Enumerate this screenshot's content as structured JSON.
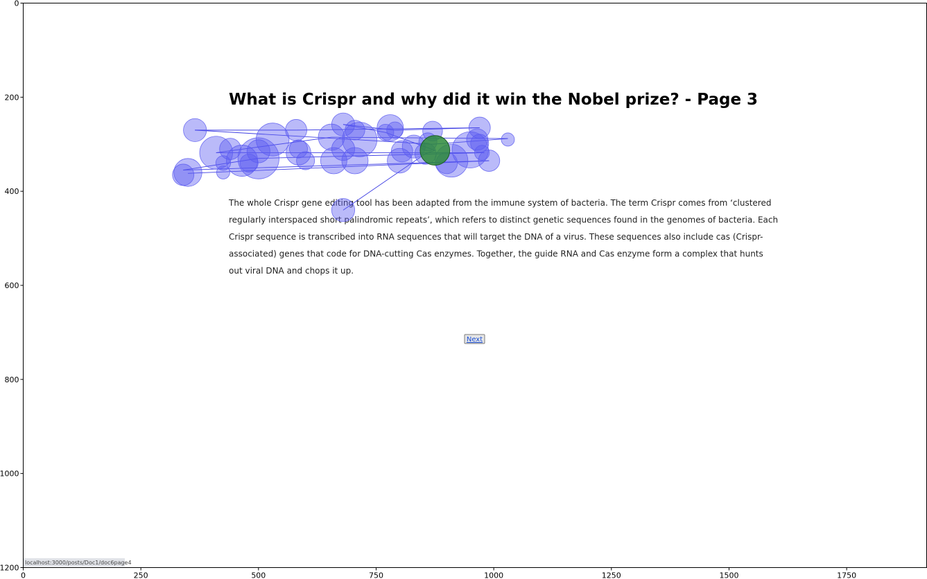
{
  "page": {
    "title": "What is Crispr and why did it win the Nobel prize? - Page 3",
    "paragraph_lines": [
      "The whole Crispr gene editing tool has been adapted from the immune system of bacteria. The term Crispr comes from ‘clustered",
      "regularly interspaced short palindromic repeats’, which refers to distinct genetic sequences found in the genomes of bacteria. Each",
      "Crispr sequence is transcribed into RNA sequences that will target the DNA of a virus. These sequences also include cas (Crispr-",
      "associated) genes that code for DNA-cutting Cas enzymes. Together, the guide RNA and Cas enzyme form a complex that hunts",
      "out viral DNA and chops it up."
    ],
    "next_button_label": "Next",
    "status_url": "localhost:3000/posts/Doc1/doc6page4"
  },
  "chart_data": {
    "type": "scatter",
    "title": "",
    "xlabel": "",
    "ylabel": "",
    "xlim": [
      0,
      1920
    ],
    "ylim": [
      1200,
      0
    ],
    "x_ticks": [
      0,
      250,
      500,
      750,
      1000,
      1250,
      1500,
      1750
    ],
    "y_ticks": [
      0,
      200,
      400,
      600,
      800,
      1000,
      1200
    ],
    "y_inverted": true,
    "grid": false,
    "colors": {
      "fixation": "#5a5af0",
      "scanpath": "#2a2ae0",
      "current_fixation": "#2e8b3a"
    },
    "fixations": [
      {
        "x": 680,
        "y": 440,
        "r": 14
      },
      {
        "x": 855,
        "y": 320,
        "r": 13
      },
      {
        "x": 830,
        "y": 305,
        "r": 14
      },
      {
        "x": 770,
        "y": 275,
        "r": 10
      },
      {
        "x": 680,
        "y": 258,
        "r": 14
      },
      {
        "x": 705,
        "y": 270,
        "r": 12
      },
      {
        "x": 780,
        "y": 265,
        "r": 16
      },
      {
        "x": 790,
        "y": 270,
        "r": 10
      },
      {
        "x": 870,
        "y": 272,
        "r": 12
      },
      {
        "x": 970,
        "y": 265,
        "r": 13
      },
      {
        "x": 1030,
        "y": 290,
        "r": 8
      },
      {
        "x": 965,
        "y": 290,
        "r": 13
      },
      {
        "x": 860,
        "y": 295,
        "r": 11
      },
      {
        "x": 715,
        "y": 290,
        "r": 21
      },
      {
        "x": 655,
        "y": 285,
        "r": 16
      },
      {
        "x": 580,
        "y": 270,
        "r": 13
      },
      {
        "x": 530,
        "y": 290,
        "r": 20
      },
      {
        "x": 365,
        "y": 270,
        "r": 14
      },
      {
        "x": 410,
        "y": 318,
        "r": 20
      },
      {
        "x": 440,
        "y": 310,
        "r": 13
      },
      {
        "x": 500,
        "y": 315,
        "r": 14
      },
      {
        "x": 585,
        "y": 310,
        "r": 11
      },
      {
        "x": 585,
        "y": 318,
        "r": 15
      },
      {
        "x": 680,
        "y": 310,
        "r": 14
      },
      {
        "x": 805,
        "y": 315,
        "r": 13
      },
      {
        "x": 950,
        "y": 312,
        "r": 22
      },
      {
        "x": 970,
        "y": 298,
        "r": 11
      },
      {
        "x": 975,
        "y": 318,
        "r": 9
      },
      {
        "x": 990,
        "y": 335,
        "r": 13
      },
      {
        "x": 910,
        "y": 335,
        "r": 20
      },
      {
        "x": 900,
        "y": 340,
        "r": 13
      },
      {
        "x": 800,
        "y": 335,
        "r": 15
      },
      {
        "x": 705,
        "y": 335,
        "r": 16
      },
      {
        "x": 660,
        "y": 335,
        "r": 16
      },
      {
        "x": 600,
        "y": 335,
        "r": 11
      },
      {
        "x": 500,
        "y": 330,
        "r": 25
      },
      {
        "x": 465,
        "y": 335,
        "r": 19
      },
      {
        "x": 480,
        "y": 340,
        "r": 11
      },
      {
        "x": 425,
        "y": 340,
        "r": 9
      },
      {
        "x": 425,
        "y": 360,
        "r": 8
      },
      {
        "x": 350,
        "y": 360,
        "r": 17
      },
      {
        "x": 340,
        "y": 365,
        "r": 13
      }
    ],
    "current_fixation": {
      "x": 875,
      "y": 313,
      "r": 18
    },
    "scanpath": [
      {
        "x": 680,
        "y": 440
      },
      {
        "x": 855,
        "y": 320
      },
      {
        "x": 875,
        "y": 313
      },
      {
        "x": 770,
        "y": 275
      },
      {
        "x": 680,
        "y": 258
      },
      {
        "x": 790,
        "y": 270
      },
      {
        "x": 970,
        "y": 265
      },
      {
        "x": 580,
        "y": 270
      },
      {
        "x": 365,
        "y": 270
      },
      {
        "x": 870,
        "y": 300
      },
      {
        "x": 1030,
        "y": 288
      },
      {
        "x": 655,
        "y": 285
      },
      {
        "x": 410,
        "y": 318
      },
      {
        "x": 980,
        "y": 318
      },
      {
        "x": 500,
        "y": 330
      },
      {
        "x": 340,
        "y": 355
      },
      {
        "x": 990,
        "y": 335
      },
      {
        "x": 350,
        "y": 362
      }
    ]
  }
}
